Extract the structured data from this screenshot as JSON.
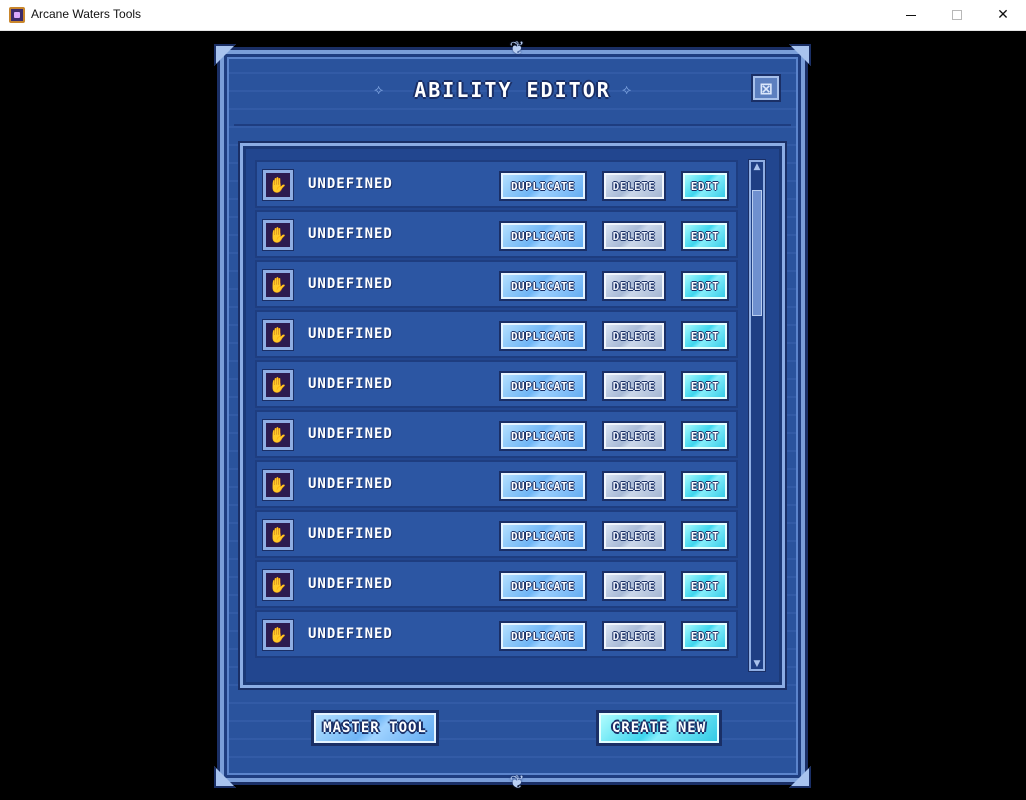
{
  "window": {
    "title": "Arcane Waters Tools",
    "app_icon": "arcane-waters-icon",
    "minimize_icon": "minimize-icon",
    "maximize_icon": "maximize-icon",
    "close_icon": "close-icon",
    "close_glyph": "✕"
  },
  "panel": {
    "title": "ABILITY EDITOR",
    "close_glyph": "⊠",
    "ornament_glyph": "❦",
    "title_deco_left": "⟡",
    "title_deco_right": "⟡"
  },
  "abilities": [
    {
      "name": "UNDEFINED",
      "icon": "hand-icon"
    },
    {
      "name": "UNDEFINED",
      "icon": "hand-icon"
    },
    {
      "name": "UNDEFINED",
      "icon": "hand-icon"
    },
    {
      "name": "UNDEFINED",
      "icon": "hand-icon"
    },
    {
      "name": "UNDEFINED",
      "icon": "hand-icon"
    },
    {
      "name": "UNDEFINED",
      "icon": "hand-icon"
    },
    {
      "name": "UNDEFINED",
      "icon": "hand-icon"
    },
    {
      "name": "UNDEFINED",
      "icon": "hand-icon"
    },
    {
      "name": "UNDEFINED",
      "icon": "hand-icon"
    },
    {
      "name": "UNDEFINED",
      "icon": "hand-icon"
    }
  ],
  "row_buttons": {
    "duplicate": "DUPLICATE",
    "delete": "DELETE",
    "edit": "EDIT"
  },
  "footer": {
    "master_tool": "MASTER TOOL",
    "create_new": "CREATE NEW"
  },
  "colors": {
    "panel_bg": "#2c56a3",
    "frame_dark": "#1a2f66",
    "duplicate_btn": "#6fb5f5",
    "delete_btn": "#a9bad6",
    "edit_btn": "#3fd6ee"
  }
}
